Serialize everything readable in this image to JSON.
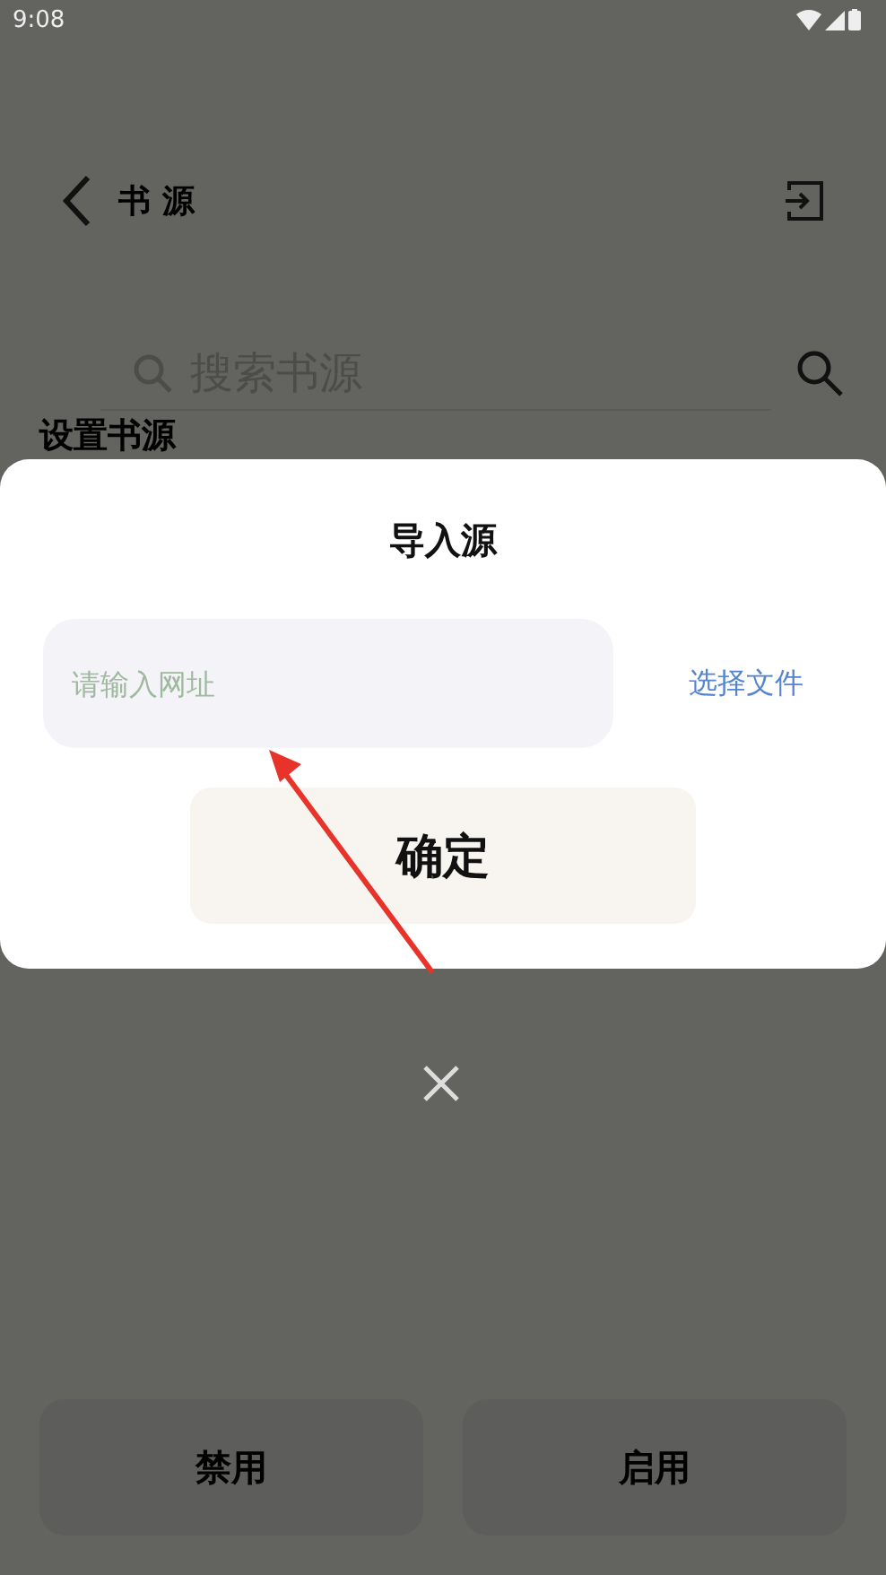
{
  "status_bar": {
    "time": "9:08"
  },
  "header": {
    "title": "书 源"
  },
  "search": {
    "placeholder": "搜索书源"
  },
  "section": {
    "title": "设置书源"
  },
  "dialog": {
    "title": "导入源",
    "url_field": {
      "placeholder": "请输入网址"
    },
    "choose_file": "选择文件",
    "confirm": "确定"
  },
  "bottom_buttons": [
    {
      "label": "禁用"
    },
    {
      "label": "启用"
    }
  ]
}
